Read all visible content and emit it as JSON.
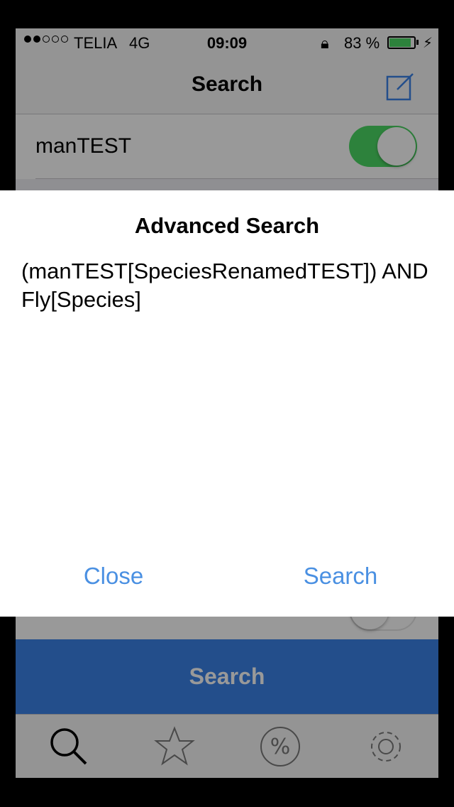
{
  "status_bar": {
    "carrier": "TELIA",
    "network": "4G",
    "time": "09:09",
    "battery": "83 %",
    "battery_level": 0.83
  },
  "nav": {
    "title": "Search",
    "right_icon": "compose-icon"
  },
  "list": {
    "rows": [
      {
        "label": "manTEST",
        "switch_on": true
      }
    ]
  },
  "search_button": {
    "label": "Search"
  },
  "tabbar": {
    "tabs": [
      {
        "icon": "magnifier-icon"
      },
      {
        "icon": "star-icon"
      },
      {
        "icon": "percent-icon"
      },
      {
        "icon": "gear-icon"
      }
    ]
  },
  "dialog": {
    "title": "Advanced Search",
    "message": "(manTEST[SpeciesRenamedTEST]) AND Fly[Species]",
    "close_label": "Close",
    "search_label": "Search"
  },
  "colors": {
    "accent": "#4a90e2",
    "switch_on": "#4cd964",
    "search_button": "#3b83e8"
  }
}
